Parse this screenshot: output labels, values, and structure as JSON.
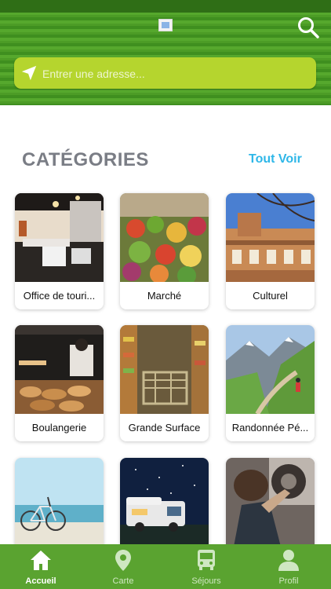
{
  "header": {
    "search_icon": "search-icon",
    "address": {
      "placeholder": "Entrer une adresse...",
      "value": ""
    }
  },
  "categories_section": {
    "title": "CATÉGORIES",
    "see_all": "Tout Voir"
  },
  "categories": [
    {
      "label": "Office de touri..."
    },
    {
      "label": "Marché"
    },
    {
      "label": "Culturel"
    },
    {
      "label": "Boulangerie"
    },
    {
      "label": "Grande Surface"
    },
    {
      "label": "Randonnée Pé..."
    },
    {
      "label": ""
    },
    {
      "label": ""
    },
    {
      "label": ""
    }
  ],
  "bottom_nav": [
    {
      "label": "Accueil",
      "icon": "home-icon",
      "active": true
    },
    {
      "label": "Carte",
      "icon": "map-pin-icon",
      "active": false
    },
    {
      "label": "Séjours",
      "icon": "bus-icon",
      "active": false
    },
    {
      "label": "Profil",
      "icon": "user-icon",
      "active": false
    }
  ],
  "colors": {
    "header_green": "#4c9c26",
    "address_bar": "#b5d52e",
    "accent_blue": "#2eb7e8",
    "nav_green": "#5aa330",
    "title_gray": "#7a7d85"
  }
}
